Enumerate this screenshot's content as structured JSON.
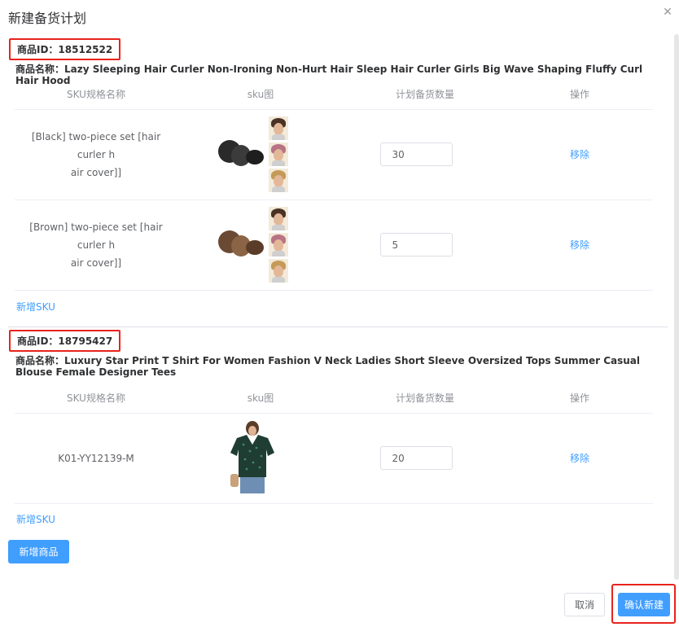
{
  "dialog": {
    "title": "新建备货计划",
    "close_icon": "close-icon"
  },
  "table_headers": {
    "sku_name": "SKU规格名称",
    "sku_image": "sku图",
    "planned_qty": "计划备货数量",
    "action": "操作"
  },
  "products": [
    {
      "id_label": "商品ID：18512522",
      "name_label": "商品名称：Lazy Sleeping Hair Curler Non-Ironing Non-Hurt Hair Sleep Hair Curler Girls Big Wave Shaping Fluffy Curl Hair Hood",
      "skus": [
        {
          "name": "[Black] two-piece set [hair curler hair cover]",
          "name_line1": "[Black] two-piece set [hair curler h",
          "name_line2": "air cover]]",
          "qty": "30",
          "action": "移除",
          "image": "black-hair-curler-image"
        },
        {
          "name": "[Brown] two-piece set [hair curler hair cover]",
          "name_line1": "[Brown] two-piece set [hair curler h",
          "name_line2": "air cover]]",
          "qty": "5",
          "action": "移除",
          "image": "brown-hair-curler-image"
        }
      ],
      "add_sku": "新增SKU"
    },
    {
      "id_label": "商品ID：18795427",
      "name_label": "商品名称：Luxury Star Print T Shirt For Women Fashion V Neck Ladies Short Sleeve Oversized Tops Summer Casual Blouse Female Designer Tees",
      "skus": [
        {
          "name_line1": "K01-YY12139-M",
          "qty": "20",
          "action": "移除",
          "image": "green-tshirt-image"
        }
      ],
      "add_sku": "新增SKU"
    }
  ],
  "buttons": {
    "add_product": "新增商品",
    "cancel": "取消",
    "confirm": "确认新建"
  },
  "colors": {
    "primary": "#409eff",
    "highlight_border": "#e8231c"
  }
}
